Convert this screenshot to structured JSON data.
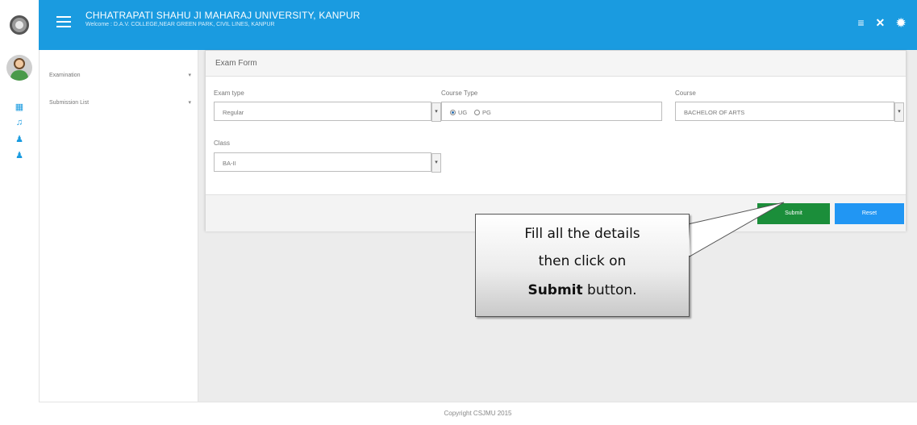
{
  "header": {
    "title": "CHHATRAPATI SHAHU JI MAHARAJ UNIVERSITY, KANPUR",
    "subtitle": "Welcome : D.A.V. COLLEGE,NEAR GREEN PARK, CIVIL LINES, KANPUR",
    "icons": [
      "menu-icon",
      "list-icon",
      "close-icon",
      "gear-icon"
    ]
  },
  "rail": {
    "icons": [
      "dashboard-icon",
      "bell-icon",
      "user-icon",
      "user-icon"
    ]
  },
  "sidebar": {
    "items": [
      {
        "label": "Examination",
        "caret": "▾"
      },
      {
        "label": "Submission List",
        "caret": "▾"
      }
    ]
  },
  "form": {
    "title": "Exam Form",
    "exam_type": {
      "label": "Exam type",
      "value": "Regular"
    },
    "course_type": {
      "label": "Course Type",
      "options": [
        "UG",
        "PG"
      ],
      "selected": "UG"
    },
    "course": {
      "label": "Course",
      "value": "BACHELOR OF ARTS"
    },
    "class": {
      "label": "Class",
      "value": "BA-II"
    },
    "submit_label": "Submit",
    "reset_label": "Reset"
  },
  "callout": {
    "line1": "Fill all the details",
    "line2": "then click on",
    "line3_bold": "Submit",
    "line3_rest": " button."
  },
  "footer": {
    "text": "Copyright CSJMU 2015"
  },
  "colors": {
    "accent": "#1a9be0",
    "submit": "#1b8e3a",
    "reset": "#2196f3"
  }
}
